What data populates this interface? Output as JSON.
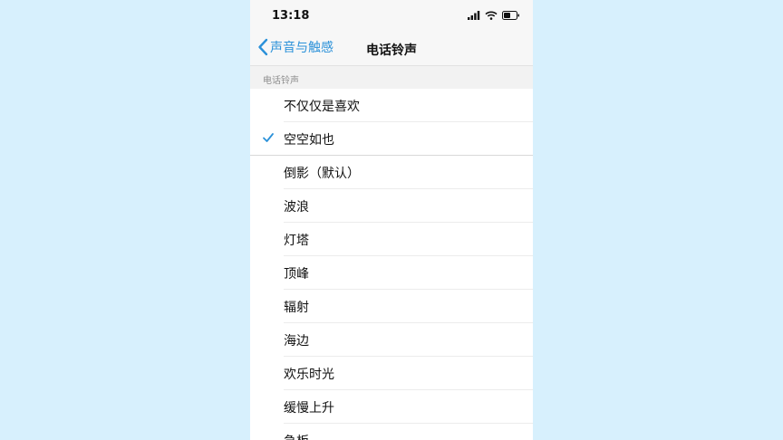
{
  "status": {
    "time": "13:18",
    "icons": [
      "signal-icon",
      "wifi-icon",
      "battery-icon"
    ]
  },
  "nav": {
    "back_label": "声音与触感",
    "title": "电话铃声"
  },
  "section": {
    "header": "电话铃声"
  },
  "ringtones": [
    {
      "label": "不仅仅是喜欢",
      "selected": false
    },
    {
      "label": "空空如也",
      "selected": true
    },
    {
      "label": "倒影（默认）",
      "selected": false
    },
    {
      "label": "波浪",
      "selected": false
    },
    {
      "label": "灯塔",
      "selected": false
    },
    {
      "label": "顶峰",
      "selected": false
    },
    {
      "label": "辐射",
      "selected": false
    },
    {
      "label": "海边",
      "selected": false
    },
    {
      "label": "欢乐时光",
      "selected": false
    },
    {
      "label": "缓慢上升",
      "selected": false
    },
    {
      "label": "急板",
      "selected": false
    }
  ],
  "colors": {
    "accent": "#2b91d9",
    "background": "#d7f0fd"
  }
}
